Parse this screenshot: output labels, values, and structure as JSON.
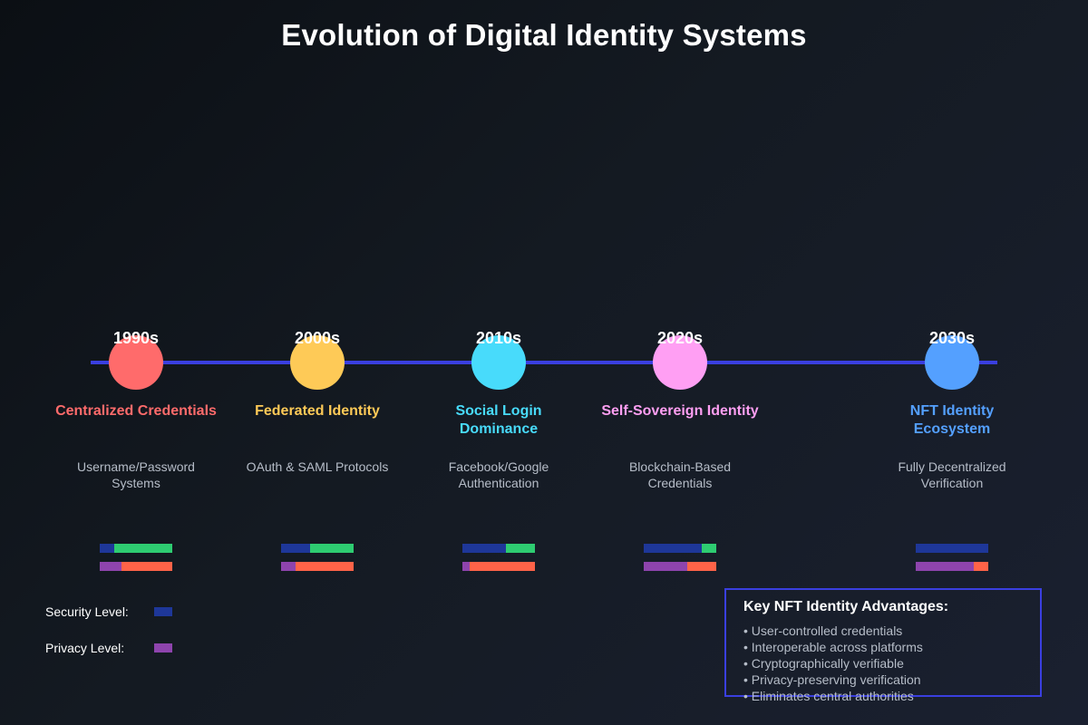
{
  "title": "Evolution of Digital Identity Systems",
  "colors": {
    "timeline": "#3a3fe0",
    "security_base": "#2ecc71",
    "security_fill": "#1e3799",
    "privacy_base": "#ff6348",
    "privacy_fill": "#8e44ad"
  },
  "eras": [
    {
      "year": "1990s",
      "name": "Centralized Credentials",
      "description": "Username/Password Systems",
      "color": "#ff6b6b",
      "security_level": 0.2,
      "privacy_level": 0.3
    },
    {
      "year": "2000s",
      "name": "Federated Identity",
      "description": "OAuth & SAML Protocols",
      "color": "#feca57",
      "security_level": 0.4,
      "privacy_level": 0.2
    },
    {
      "year": "2010s",
      "name": "Social Login Dominance",
      "description": "Facebook/Google Authentication",
      "color": "#48dbfb",
      "security_level": 0.6,
      "privacy_level": 0.1
    },
    {
      "year": "2020s",
      "name": "Self-Sovereign Identity",
      "description": "Blockchain-Based Credentials",
      "color": "#ff9ff3",
      "security_level": 0.8,
      "privacy_level": 0.6
    },
    {
      "year": "2030s",
      "name": "NFT Identity Ecosystem",
      "description": "Fully Decentralized Verification",
      "color": "#54a0ff",
      "security_level": 1.0,
      "privacy_level": 0.8
    }
  ],
  "legend": {
    "security_label": "Security Level:",
    "privacy_label": "Privacy Level:"
  },
  "advantages": {
    "title": "Key NFT Identity Advantages:",
    "items": [
      "• User-controlled credentials",
      "• Interoperable across platforms",
      "• Cryptographically verifiable",
      "• Privacy-preserving verification",
      "• Eliminates central authorities"
    ]
  }
}
